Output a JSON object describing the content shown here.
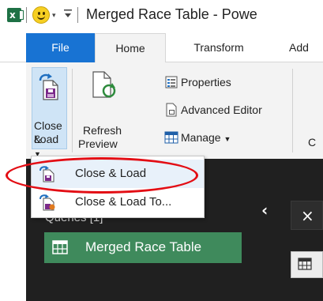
{
  "titlebar": {
    "window_title": "Merged Race Table - Powe",
    "excel_letter": "x"
  },
  "tabs": [
    {
      "label": "File"
    },
    {
      "label": "Home"
    },
    {
      "label": "Transform"
    },
    {
      "label": "Add"
    }
  ],
  "ribbon": {
    "close_load_line1": "Close &",
    "close_load_line2": "Load",
    "refresh_line1": "Refresh",
    "refresh_line2": "Preview",
    "properties": "Properties",
    "advanced_editor": "Advanced Editor",
    "manage": "Manage",
    "truncated_group": "C"
  },
  "dropdown": {
    "items": [
      {
        "label": "Close & Load",
        "highlighted": true
      },
      {
        "label": "Close & Load To..."
      }
    ]
  },
  "queries_pane": {
    "header": "Queries [1]",
    "items": [
      {
        "label": "Merged Race Table"
      }
    ]
  },
  "colors": {
    "file_tab": "#1873d3",
    "query_selected": "#3f8a5c",
    "annotation_ring": "#e30d14",
    "dark_background": "#202020"
  }
}
